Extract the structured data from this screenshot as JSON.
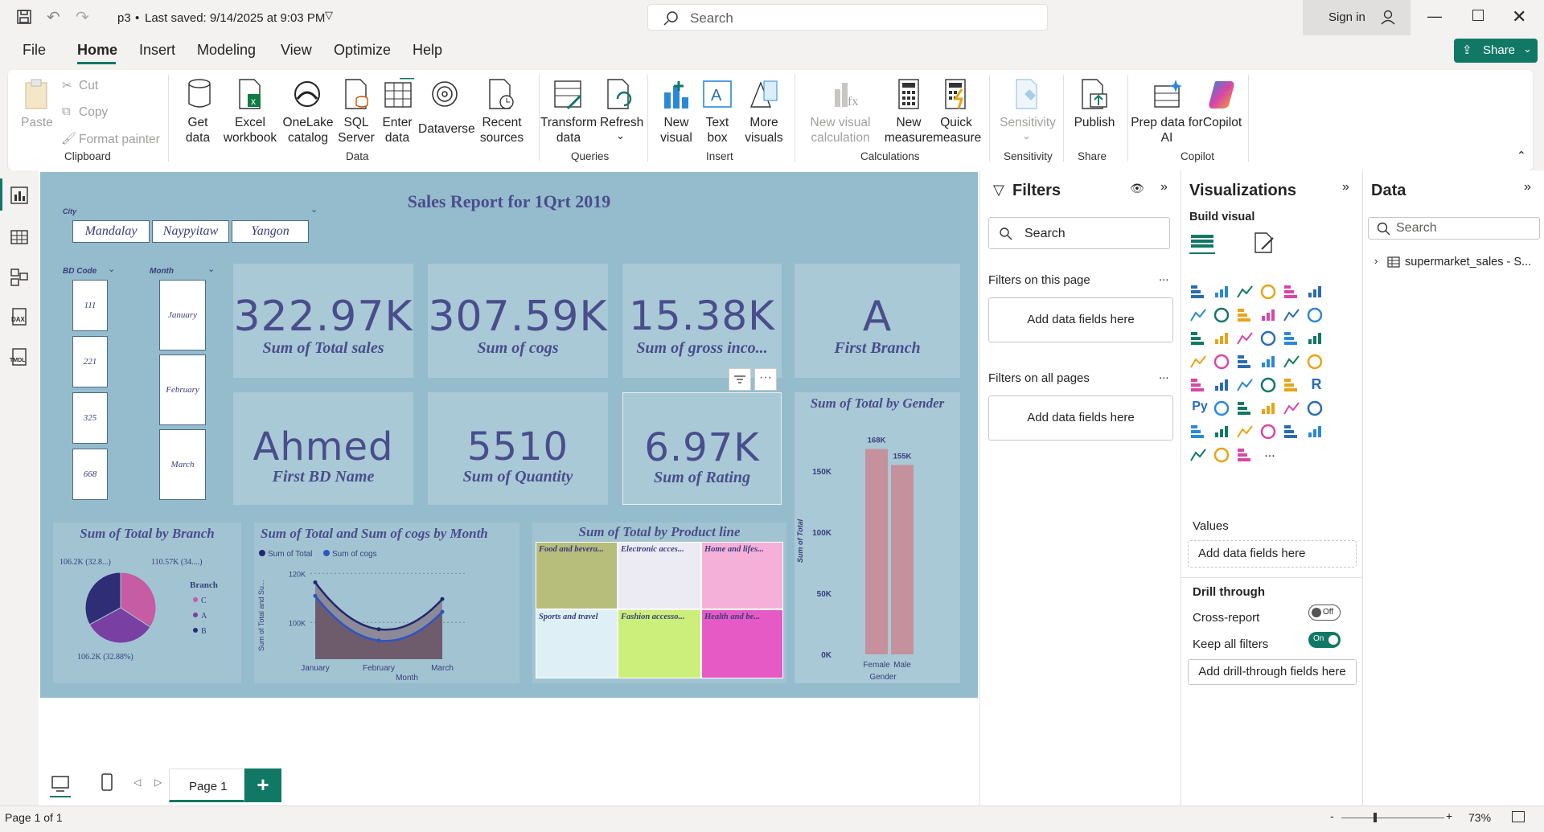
{
  "titlebar": {
    "filename": "p3",
    "saved": "Last saved: 9/14/2025 at 9:03 PM",
    "search_placeholder": "Search",
    "signin": "Sign in"
  },
  "menu": {
    "file": "File",
    "home": "Home",
    "insert": "Insert",
    "modeling": "Modeling",
    "view": "View",
    "optimize": "Optimize",
    "help": "Help",
    "share": "Share"
  },
  "ribbon": {
    "paste": "Paste",
    "cut": "Cut",
    "copy": "Copy",
    "format_painter": "Format painter",
    "clipboard": "Clipboard",
    "get_data": "Get data",
    "excel": "Excel workbook",
    "onelake": "OneLake catalog",
    "sql": "SQL Server",
    "enter": "Enter data",
    "dataverse": "Dataverse",
    "recent": "Recent sources",
    "data_group": "Data",
    "transform": "Transform data",
    "refresh": "Refresh",
    "queries": "Queries",
    "new_visual": "New visual",
    "text_box": "Text box",
    "more_visuals": "More visuals",
    "insert_group": "Insert",
    "new_calc": "New visual calculation",
    "new_measure": "New measure",
    "quick_measure": "Quick measure",
    "calculations": "Calculations",
    "sensitivity": "Sensitivity",
    "sensitivity_group": "Sensitivity",
    "publish": "Publish",
    "share_group": "Share",
    "prep": "Prep data for AI",
    "copilot": "Copilot",
    "copilot_group": "Copilot"
  },
  "report": {
    "title": "Sales Report for 1Qrt 2019",
    "city_slicer": {
      "label": "City",
      "items": [
        "Mandalay",
        "Naypyitaw",
        "Yangon"
      ]
    },
    "bd_slicer": {
      "label": "BD Code",
      "items": [
        "111",
        "221",
        "325",
        "668"
      ]
    },
    "month_slicer": {
      "label": "Month",
      "items": [
        "January",
        "February",
        "March"
      ]
    },
    "cards": [
      {
        "value": "322.97K",
        "label": "Sum of Total sales"
      },
      {
        "value": "307.59K",
        "label": "Sum of cogs"
      },
      {
        "value": "15.38K",
        "label": "Sum of gross inco..."
      },
      {
        "value": "A",
        "label": "First Branch"
      },
      {
        "value": "Ahmed",
        "label": "First BD Name"
      },
      {
        "value": "5510",
        "label": "Sum of Quantity"
      },
      {
        "value": "6.97K",
        "label": "Sum of Rating"
      }
    ],
    "pie": {
      "title": "Sum of Total by Branch",
      "legend_title": "Branch",
      "legend": [
        "C",
        "A",
        "B"
      ],
      "labels": [
        "110.57K (34....)",
        "106.2K (32.8...)",
        "106.2K (32.88%)"
      ]
    },
    "line": {
      "title": "Sum of Total and Sum of cogs by Month",
      "legend": [
        "Sum of Total",
        "Sum of cogs"
      ],
      "yticks": [
        "120K",
        "100K"
      ],
      "xticks": [
        "January",
        "February",
        "March"
      ],
      "xlabel": "Month",
      "ylabel": "Sum of Total and Su..."
    },
    "treemap": {
      "title": "Sum of Total by Product line",
      "items": [
        "Food and bevera...",
        "Electronic acces...",
        "Home and lifes...",
        "Sports and travel",
        "Fashion accesso...",
        "Health and be..."
      ]
    },
    "bar": {
      "title": "Sum of Total by Gender",
      "yticks": [
        "150K",
        "100K",
        "50K",
        "0K"
      ],
      "ylabel": "Sum of Total",
      "xlabel": "Gender",
      "cats": [
        "Female",
        "Male"
      ],
      "labels": [
        "168K",
        "155K"
      ]
    }
  },
  "chart_data": [
    {
      "type": "pie",
      "title": "Sum of Total by Branch",
      "categories": [
        "C",
        "A",
        "B"
      ],
      "values": [
        110.57,
        106.2,
        106.2
      ]
    },
    {
      "type": "line",
      "title": "Sum of Total and Sum of cogs by Month",
      "categories": [
        "January",
        "February",
        "March"
      ],
      "series": [
        {
          "name": "Sum of Total",
          "values": [
            116.3,
            97.2,
            109.5
          ]
        },
        {
          "name": "Sum of cogs",
          "values": [
            110.8,
            92.6,
            104.3
          ]
        }
      ],
      "ylim": [
        85,
        125
      ]
    },
    {
      "type": "bar",
      "title": "Sum of Total by Gender",
      "categories": [
        "Female",
        "Male"
      ],
      "values": [
        168,
        155
      ],
      "ylim": [
        0,
        175
      ]
    }
  ],
  "filters": {
    "title": "Filters",
    "search": "Search",
    "on_page": "Filters on this page",
    "add": "Add data fields here",
    "on_all": "Filters on all pages",
    "more": "..."
  },
  "viz": {
    "title": "Visualizations",
    "build": "Build visual",
    "values": "Values",
    "add": "Add data fields here",
    "drill": "Drill through",
    "cross": "Cross-report",
    "cross_state": "Off",
    "keep": "Keep all filters",
    "keep_state": "On",
    "add_drill": "Add drill-through fields here",
    "r": "R",
    "py": "Py",
    "more": "..."
  },
  "data": {
    "title": "Data",
    "search": "Search",
    "table": "supermarket_sales - S..."
  },
  "pages": {
    "page1": "Page 1"
  },
  "status": {
    "page": "Page 1 of 1",
    "zoom": "73%"
  }
}
